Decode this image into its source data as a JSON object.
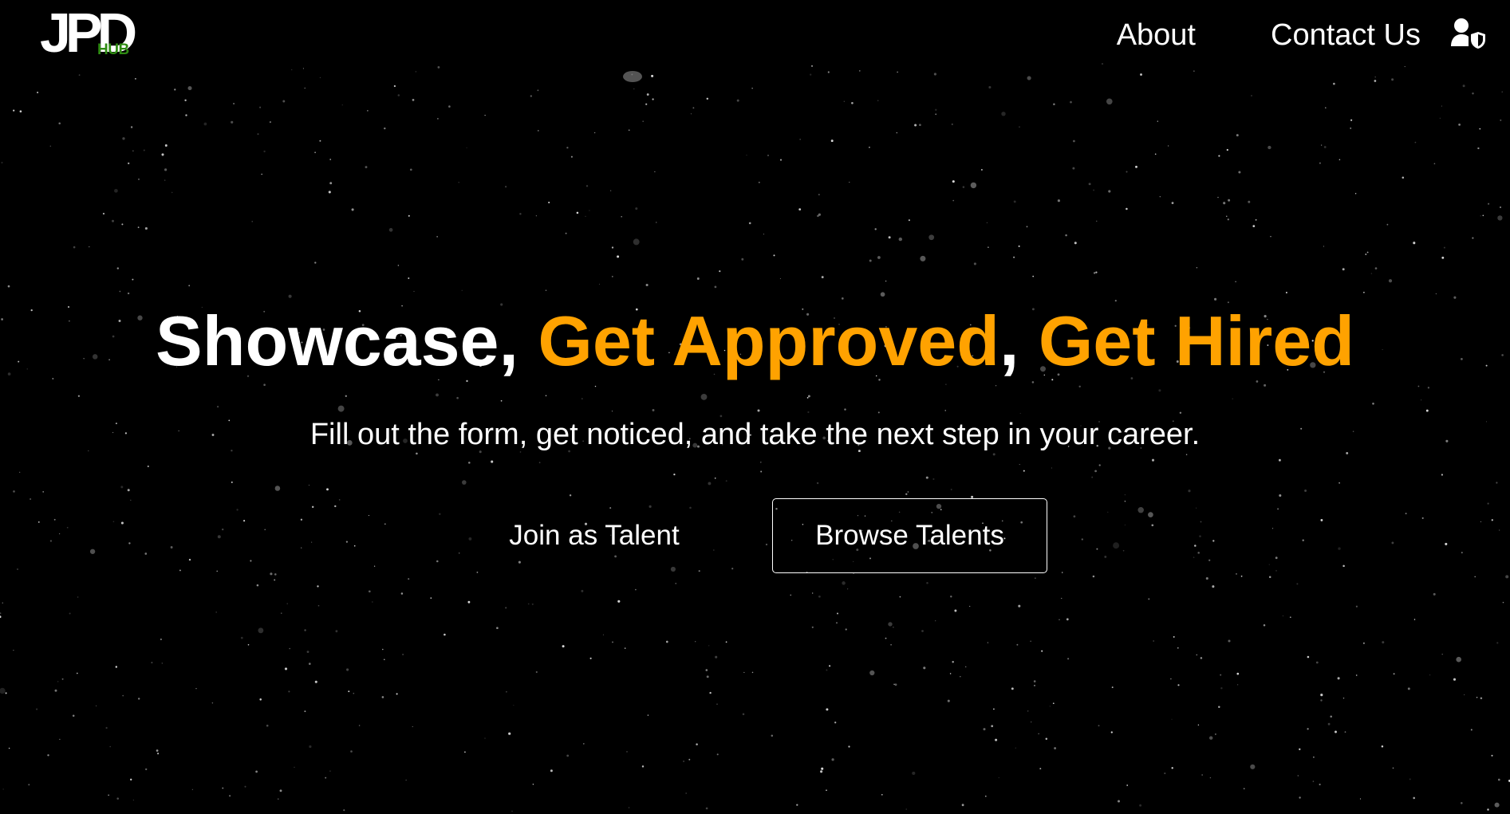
{
  "header": {
    "logo": {
      "word": "JPD",
      "sub": "HUB",
      "sub_color": "#2e8b12"
    },
    "nav": {
      "about_label": "About",
      "contact_label": "Contact Us",
      "user_icon": "user-shield-icon"
    }
  },
  "hero": {
    "title_part1": "Showcase, ",
    "title_part2": "Get Approved",
    "title_part3": ", ",
    "title_part4": "Get Hired",
    "subtitle": "Fill out the form, get noticed, and take the next step in your career.",
    "join_button_label": "Join as Talent",
    "browse_button_label": "Browse Talents"
  },
  "colors": {
    "background": "#000000",
    "text": "#ffffff",
    "accent": "#ffa200"
  }
}
